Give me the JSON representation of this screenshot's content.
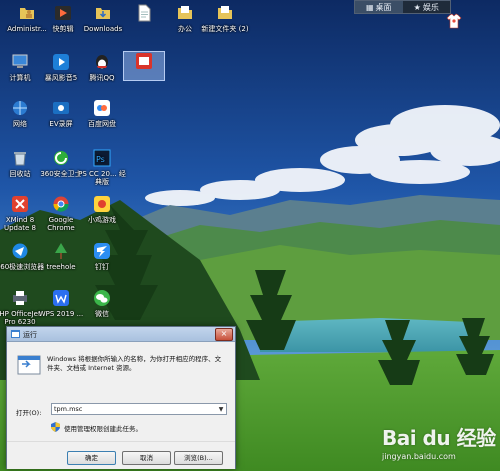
{
  "top_bar": {
    "tabs": [
      {
        "label": "桌面",
        "icon": "desktop-icon"
      },
      {
        "label": "娱乐",
        "icon": "star-icon"
      }
    ]
  },
  "desktop_icons": [
    {
      "label": "Administr...",
      "icon": "folder-user-icon"
    },
    {
      "label": "快剪辑",
      "icon": "video-editor-icon"
    },
    {
      "label": "Downloads",
      "icon": "downloads-folder-icon"
    },
    {
      "label": "",
      "icon": "document-icon"
    },
    {
      "label": "办公",
      "icon": "folder-icon"
    },
    {
      "label": "新建文件夹 (2)",
      "icon": "folder-icon"
    },
    {
      "label": "计算机",
      "icon": "computer-icon"
    },
    {
      "label": "暴风影音5",
      "icon": "media-player-icon"
    },
    {
      "label": "腾讯QQ",
      "icon": "qq-penguin-icon"
    },
    {
      "label": "",
      "icon": "app-icon"
    },
    {
      "label": "网络",
      "icon": "network-icon"
    },
    {
      "label": "EV录屏",
      "icon": "screen-recorder-icon"
    },
    {
      "label": "百度网盘",
      "icon": "cloud-drive-icon"
    },
    {
      "label": "回收站",
      "icon": "recycle-bin-icon"
    },
    {
      "label": "360安全卫士",
      "icon": "security-shield-icon"
    },
    {
      "label": "PS CC 20... 经典版",
      "icon": "photoshop-icon"
    },
    {
      "label": "XMind 8 Update 8",
      "icon": "mindmap-icon"
    },
    {
      "label": "Google Chrome",
      "icon": "chrome-icon"
    },
    {
      "label": "小鸡游戏",
      "icon": "game-icon"
    },
    {
      "label": "360极速浏览器",
      "icon": "browser-icon"
    },
    {
      "label": "treehole",
      "icon": "tree-app-icon"
    },
    {
      "label": "钉钉",
      "icon": "dingtalk-icon"
    },
    {
      "label": "HP OfficeJet Pro 6230",
      "icon": "printer-icon"
    },
    {
      "label": "WPS 2019 ...",
      "icon": "wps-icon"
    },
    {
      "label": "微信",
      "icon": "wechat-icon"
    }
  ],
  "run_dialog": {
    "title": "运行",
    "close": "×",
    "description": "Windows 将根据你所输入的名称，为你打开相应的程序、文件夹、文档或 Internet 资源。",
    "open_label": "打开(O):",
    "input_value": "tpm.msc",
    "admin_note": "使用管理权限创建此任务。",
    "buttons": {
      "ok": "确定",
      "cancel": "取消",
      "browse": "浏览(B)..."
    }
  },
  "watermark": {
    "brand": "Bai du 经验",
    "url": "jingyan.baidu.com"
  }
}
